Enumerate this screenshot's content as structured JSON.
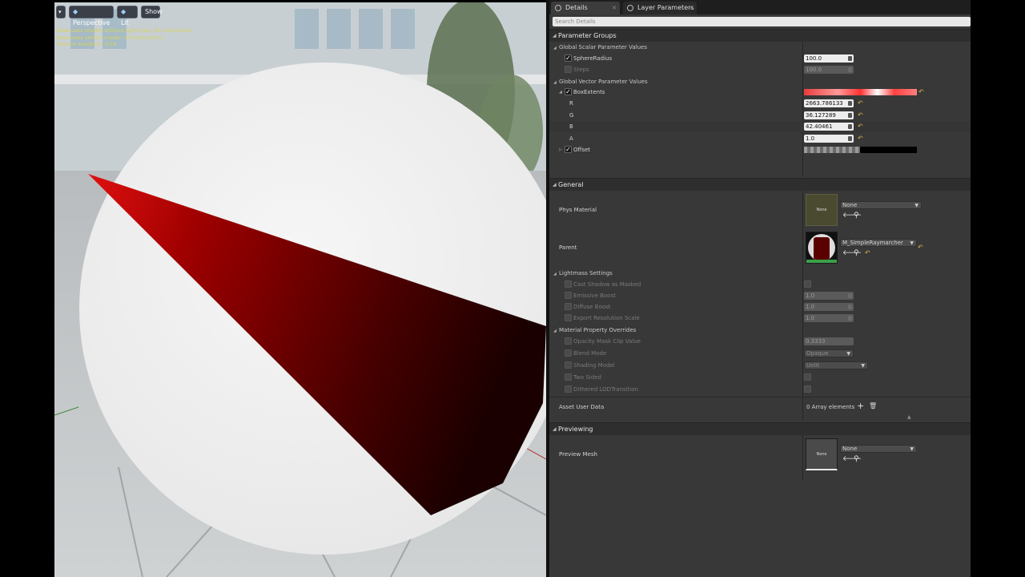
{
  "viewport": {
    "toolbar": {
      "menu_icon": "chevron-down-icon",
      "perspective_label": "Perspective",
      "lit_label": "Lit",
      "show_label": "Show"
    },
    "stats": [
      "Base pass shader without light map: 90 instructions",
      "Base pass vertex shader: 40 instructions",
      "Texture samplers: 0/16"
    ]
  },
  "tabs": [
    {
      "label": "Details",
      "icon": "details-icon"
    },
    {
      "label": "Layer Parameters",
      "icon": "layer-parameters-icon"
    }
  ],
  "search": {
    "placeholder": "Search Details"
  },
  "parameter_groups": {
    "title": "Parameter Groups",
    "scalar_group": {
      "title": "Global Scalar Parameter Values",
      "items": [
        {
          "label": "SphereRadius",
          "value": "100.0",
          "checked": true,
          "enabled": true
        },
        {
          "label": "Steps",
          "value": "100.0",
          "checked": false,
          "enabled": false
        }
      ]
    },
    "vector_group": {
      "title": "Global Vector Parameter Values",
      "box_extents": {
        "label": "BoxExtents",
        "checked": true,
        "components": [
          {
            "label": "R",
            "value": "2663.786133"
          },
          {
            "label": "G",
            "value": "36.127289"
          },
          {
            "label": "B",
            "value": "42.40461"
          },
          {
            "label": "A",
            "value": "1.0"
          }
        ]
      },
      "offset": {
        "label": "Offset",
        "checked": true
      }
    }
  },
  "general": {
    "title": "General",
    "phys_material": {
      "label": "Phys Material",
      "thumb_text": "None",
      "value": "None"
    },
    "parent": {
      "label": "Parent",
      "value": "M_SimpleRaymarcher"
    },
    "lightmass": {
      "title": "Lightmass Settings",
      "items": [
        {
          "label": "Cast Shadow as Masked",
          "type": "checkbox"
        },
        {
          "label": "Emissive Boost",
          "value": "1.0"
        },
        {
          "label": "Diffuse Boost",
          "value": "1.0"
        },
        {
          "label": "Export Resolution Scale",
          "value": "1.0"
        }
      ]
    },
    "overrides": {
      "title": "Material Property Overrides",
      "opacity_mask_clip": {
        "label": "Opacity Mask Clip Value",
        "value": "0.3333"
      },
      "blend_mode": {
        "label": "Blend Mode",
        "value": "Opaque"
      },
      "shading_model": {
        "label": "Shading Model",
        "value": "Unlit"
      },
      "two_sided": {
        "label": "Two Sided"
      },
      "dithered_lod": {
        "label": "Dithered LODTransition"
      }
    },
    "asset_user_data": {
      "label": "Asset User Data",
      "value": "0 Array elements"
    }
  },
  "previewing": {
    "title": "Previewing",
    "preview_mesh": {
      "label": "Preview Mesh",
      "thumb_text": "None",
      "value": "None"
    }
  },
  "colors": {
    "panel_bg": "#383838",
    "category_bg": "#2e2e2e",
    "reset_arrow": "#d9b34a",
    "cone_red": "#8a0000"
  }
}
